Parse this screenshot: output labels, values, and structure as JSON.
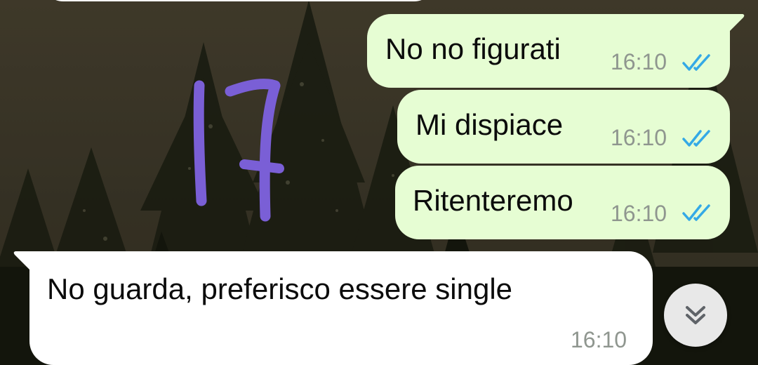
{
  "conversation": {
    "messages": [
      {
        "direction": "outgoing",
        "text": "No no figurati",
        "time": "16:10",
        "status": "read"
      },
      {
        "direction": "outgoing",
        "text": "Mi dispiace",
        "time": "16:10",
        "status": "read"
      },
      {
        "direction": "outgoing",
        "text": "Ritenteremo",
        "time": "16:10",
        "status": "read"
      },
      {
        "direction": "incoming",
        "text": "No guarda, preferisco essere single",
        "time": "16:10"
      }
    ]
  },
  "annotation": {
    "handwritten_number": "17",
    "color": "#7a5fd6"
  },
  "colors": {
    "outgoing_bubble": "#e6fdd3",
    "incoming_bubble": "#ffffff",
    "timestamp": "#8f968f",
    "read_ticks": "#34a9e6",
    "scroll_button": "#e8e8e8"
  },
  "icons": {
    "read_receipt": "double-check-icon",
    "scroll_down": "double-chevron-down-icon"
  }
}
